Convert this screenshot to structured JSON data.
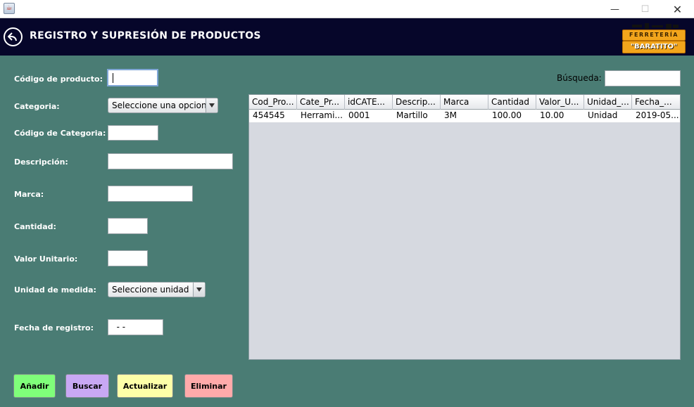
{
  "window": {
    "minimize_glyph": "—",
    "maximize_glyph": "☐",
    "close_glyph": "✕"
  },
  "header": {
    "title": "REGISTRO Y SUPRESIÓN DE PRODUCTOS",
    "logo_top": "FERRETERÍA",
    "logo_bottom": "\"BARATITO\""
  },
  "form": {
    "codigo_producto": {
      "label": "Código de producto:",
      "value": ""
    },
    "categoria": {
      "label": "Categoria:",
      "selected": "Seleccione una opcion"
    },
    "codigo_categoria": {
      "label": "Código de Categoria:",
      "value": ""
    },
    "descripcion": {
      "label": "Descripción:",
      "value": ""
    },
    "marca": {
      "label": "Marca:",
      "value": ""
    },
    "cantidad": {
      "label": "Cantidad:",
      "value": ""
    },
    "valor_unitario": {
      "label": "Valor Unitario:",
      "value": ""
    },
    "unidad_medida": {
      "label": "Unidad de medida:",
      "selected": "Seleccione unidad"
    },
    "fecha_registro": {
      "label": "Fecha de registro:",
      "value": "  - -"
    }
  },
  "search": {
    "label": "Búsqueda:",
    "value": ""
  },
  "table": {
    "columns": [
      "Cod_Pro...",
      "Cate_Pr...",
      "idCATE...",
      "Descrip...",
      "Marca",
      "Cantidad",
      "Valor_U...",
      "Unidad_...",
      "Fecha_..."
    ],
    "rows": [
      [
        "454545",
        "Herrami...",
        "0001",
        "Martillo",
        "3M",
        "100.00",
        "10.00",
        "Unidad",
        "2019-05..."
      ]
    ]
  },
  "buttons": {
    "add": "Añadir",
    "search": "Buscar",
    "update": "Actualizar",
    "delete": "Eliminar"
  },
  "colors": {
    "background": "#4a7c74",
    "header": "#06062a",
    "btn_add": "#7fff7a",
    "btn_search": "#c8a8f4",
    "btn_update": "#fdffa8",
    "btn_delete": "#ffaaaa",
    "logo_plate": "#f2a51c"
  },
  "icons": {
    "back": "back-arrow-icon",
    "app": "java-app-icon",
    "dropdown": "chevron-down-icon"
  }
}
